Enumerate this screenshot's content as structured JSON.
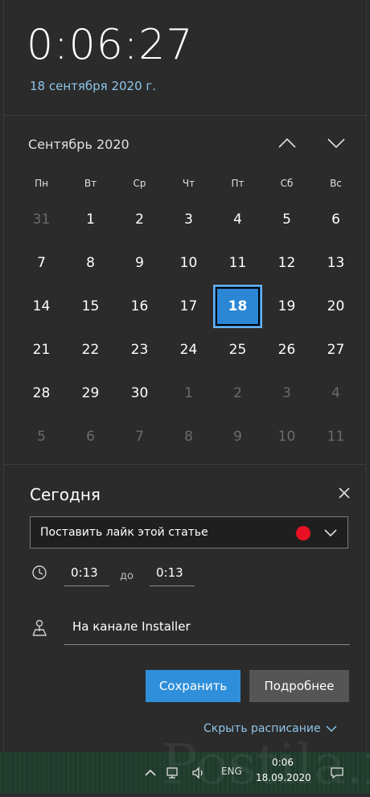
{
  "header": {
    "time": "0:06:27",
    "date": "18 сентября 2020 г."
  },
  "calendar": {
    "month_title": "Сентябрь 2020",
    "weekdays": [
      "Пн",
      "Вт",
      "Ср",
      "Чт",
      "Пт",
      "Сб",
      "Вс"
    ],
    "days": [
      {
        "n": "31",
        "dim": true
      },
      {
        "n": "1"
      },
      {
        "n": "2"
      },
      {
        "n": "3"
      },
      {
        "n": "4"
      },
      {
        "n": "5"
      },
      {
        "n": "6"
      },
      {
        "n": "7"
      },
      {
        "n": "8"
      },
      {
        "n": "9"
      },
      {
        "n": "10"
      },
      {
        "n": "11"
      },
      {
        "n": "12"
      },
      {
        "n": "13"
      },
      {
        "n": "14"
      },
      {
        "n": "15"
      },
      {
        "n": "16"
      },
      {
        "n": "17"
      },
      {
        "n": "18",
        "today": true
      },
      {
        "n": "19"
      },
      {
        "n": "20"
      },
      {
        "n": "21"
      },
      {
        "n": "22"
      },
      {
        "n": "23"
      },
      {
        "n": "24"
      },
      {
        "n": "25"
      },
      {
        "n": "26"
      },
      {
        "n": "27"
      },
      {
        "n": "28"
      },
      {
        "n": "29"
      },
      {
        "n": "30"
      },
      {
        "n": "1",
        "dim": true
      },
      {
        "n": "2",
        "dim": true
      },
      {
        "n": "3",
        "dim": true
      },
      {
        "n": "4",
        "dim": true
      },
      {
        "n": "5",
        "dim": true
      },
      {
        "n": "6",
        "dim": true
      },
      {
        "n": "7",
        "dim": true
      },
      {
        "n": "8",
        "dim": true
      },
      {
        "n": "9",
        "dim": true
      },
      {
        "n": "10",
        "dim": true
      },
      {
        "n": "11",
        "dim": true
      }
    ]
  },
  "agenda": {
    "title": "Сегодня",
    "event_value": "Поставить лайк этой статье",
    "event_color": "#e81123",
    "start_time": "0:13",
    "to_label": "до",
    "end_time": "0:13",
    "location": "На канале Installer",
    "save_label": "Сохранить",
    "more_label": "Подробнее",
    "hide_label": "Скрыть расписание"
  },
  "taskbar": {
    "lang": "ENG",
    "time": "0:06",
    "date": "18.09.2020"
  },
  "watermark": "Postila.ru",
  "colors": {
    "accent": "#2f8fda",
    "link": "#8fc6ea",
    "background": "#2b2b2b"
  }
}
